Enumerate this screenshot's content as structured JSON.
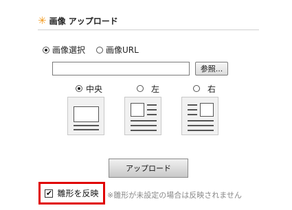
{
  "header": {
    "icon": "star-icon",
    "title": "画像 アップロード"
  },
  "source": {
    "options": [
      {
        "label": "画像選択",
        "selected": true
      },
      {
        "label": "画像URL",
        "selected": false
      }
    ]
  },
  "file": {
    "value": "",
    "browse_label": "参照..."
  },
  "alignment": {
    "options": [
      {
        "label": "中央",
        "selected": true
      },
      {
        "label": "左",
        "selected": false
      },
      {
        "label": "右",
        "selected": false
      }
    ]
  },
  "upload_button": {
    "label": "アップロード"
  },
  "reflect": {
    "checked": true,
    "label": "雛形を反映",
    "note": "※雛形が未設定の場合は反映されません"
  },
  "colors": {
    "accent": "#f39a1e",
    "highlight_border": "#e00000"
  }
}
